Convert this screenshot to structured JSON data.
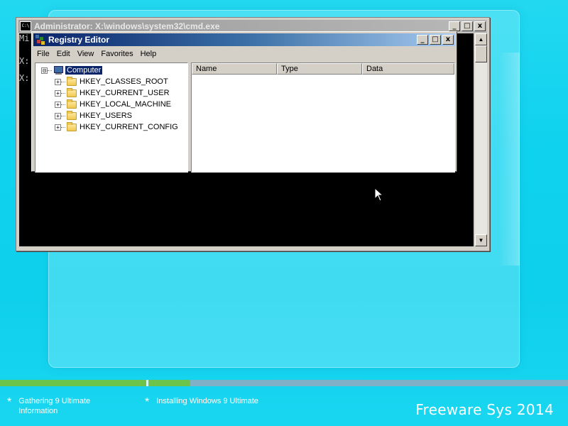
{
  "cmd_window": {
    "title": "Administrator: X:\\windows\\system32\\cmd.exe",
    "icon_text": "C:\\",
    "lines": [
      "Mi",
      "X:",
      "X:"
    ],
    "buttons": [
      "_",
      "□",
      "x"
    ]
  },
  "registry_editor": {
    "title": "Registry Editor",
    "buttons": [
      "_",
      "□",
      "x"
    ],
    "menu": [
      "File",
      "Edit",
      "View",
      "Favorites",
      "Help"
    ],
    "tree": {
      "root_expander": "⊟",
      "root": "Computer",
      "keys": [
        "HKEY_CLASSES_ROOT",
        "HKEY_CURRENT_USER",
        "HKEY_LOCAL_MACHINE",
        "HKEY_USERS",
        "HKEY_CURRENT_CONFIG"
      ],
      "child_expander": "+"
    },
    "columns": [
      "Name",
      "Type",
      "Data"
    ]
  },
  "setup": {
    "steps": [
      {
        "line1": "Gathering 9 Ultimate",
        "line2": "Information"
      },
      {
        "line1": "Installing Windows 9 Ultimate",
        "line2": ""
      }
    ],
    "star_glyph": "*",
    "brand": "Freeware Sys 2014",
    "progress": {
      "step1_fill": 1.0,
      "step2_fill": 0.1
    },
    "colors": {
      "progress_fill": "#6cc44a",
      "background": "#0fd2ee",
      "titlebar_active": "#0a246a"
    }
  }
}
